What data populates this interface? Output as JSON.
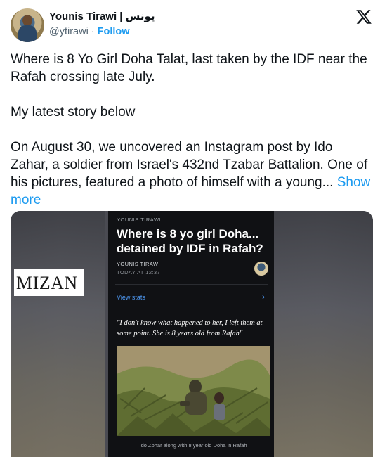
{
  "author": {
    "display_name": "Younis Tirawi | يونس",
    "handle": "@ytirawi",
    "separator": "·",
    "follow_label": "Follow"
  },
  "tweet": {
    "para1": "Where is 8 Yo Girl Doha Talat, last taken by the IDF near the Rafah crossing late July.",
    "para2": "My latest story below",
    "para3": "On August 30, we uncovered an Instagram post by Ido Zahar, a soldier from Israel's 432nd Tzabar Battalion. One of his pictures, featured a photo of himself with a young...",
    "show_more": "Show more"
  },
  "media": {
    "watermark": "MIZAN",
    "article": {
      "kicker": "YOUNIS TIRAWI",
      "title": "Where is 8 yo girl Doha... detained by IDF in Rafah?",
      "author": "YOUNIS TIRAWI",
      "time": "TODAY AT 12:37",
      "view_stats": "View stats",
      "chevron": "›",
      "quote": "\"I don't know what happened to her, I left them at some point. She is 8 years old from Rafah\"",
      "caption": "Ido Zohar along with 8 year old Doha in Rafah"
    }
  },
  "colors": {
    "accent": "#1d9bf0",
    "text": "#0f1419",
    "secondary": "#536471"
  },
  "icons": {
    "x_logo": "x-logo-icon"
  }
}
